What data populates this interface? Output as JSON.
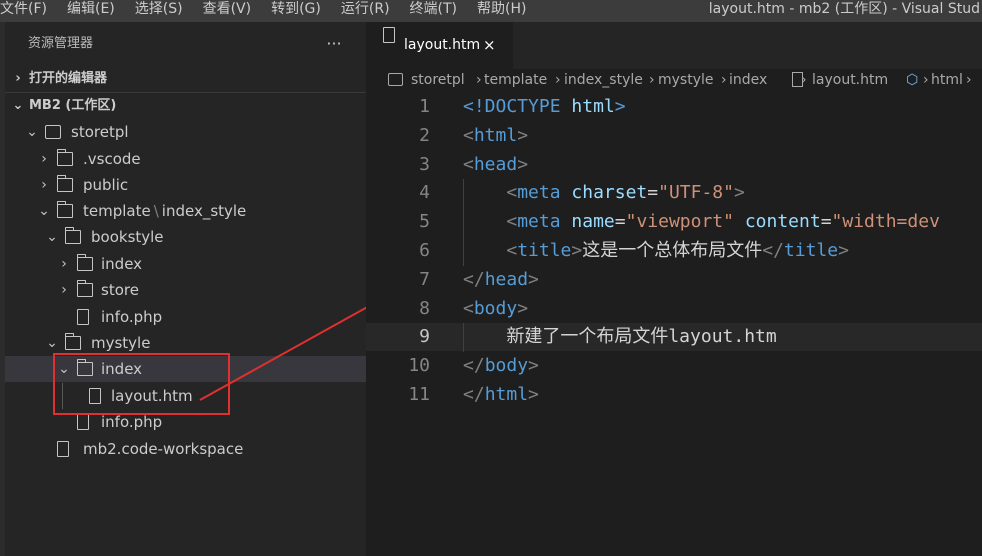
{
  "menubar": {
    "items": [
      "文件(F)",
      "编辑(E)",
      "选择(S)",
      "查看(V)",
      "转到(G)",
      "运行(R)",
      "终端(T)",
      "帮助(H)"
    ],
    "window_title": "layout.htm - mb2 (工作区) - Visual Stud"
  },
  "explorer": {
    "title": "资源管理器",
    "more": "···",
    "open_editors": "打开的编辑器",
    "workspace": "MB2 (工作区)",
    "tree": [
      {
        "label": "storetpl",
        "chevron": "⌄",
        "icon": "root-folder-icon"
      },
      {
        "label": ".vscode",
        "chevron": "›",
        "icon": "folder-icon"
      },
      {
        "label": "public",
        "chevron": "›",
        "icon": "folder-icon"
      },
      {
        "label": "template",
        "label_sep": "\\",
        "label_rest": "index_style",
        "chevron": "⌄",
        "icon": "folder-open-icon"
      },
      {
        "label": "bookstyle",
        "chevron": "⌄",
        "icon": "folder-open-icon"
      },
      {
        "label": "index",
        "chevron": "›",
        "icon": "folder-icon"
      },
      {
        "label": "store",
        "chevron": "›",
        "icon": "folder-icon"
      },
      {
        "label": "info.php",
        "icon": "file-icon"
      },
      {
        "label": "mystyle",
        "chevron": "⌄",
        "icon": "folder-open-icon"
      },
      {
        "label": "index",
        "chevron": "⌄",
        "icon": "folder-open-icon"
      },
      {
        "label": "layout.htm",
        "icon": "file-icon"
      },
      {
        "label": "info.php",
        "icon": "file-icon"
      },
      {
        "label": "mb2.code-workspace",
        "icon": "file-icon"
      }
    ]
  },
  "tab": {
    "label": "layout.htm",
    "close": "×"
  },
  "breadcrumb": {
    "items": [
      "storetpl",
      "template",
      "index_style",
      "mystyle",
      "index",
      "layout.htm",
      "html"
    ],
    "chevron": "›"
  },
  "code": {
    "line_numbers": [
      "1",
      "2",
      "3",
      "4",
      "5",
      "6",
      "7",
      "8",
      "9",
      "10",
      "11"
    ],
    "lines": [
      [
        [
          "dt",
          "<!DOCTYPE"
        ],
        [
          "tx",
          " "
        ],
        [
          "an",
          "html"
        ],
        [
          "dt",
          ">"
        ]
      ],
      [
        [
          "tg",
          "<"
        ],
        [
          "tn",
          "html"
        ],
        [
          "tg",
          ">"
        ]
      ],
      [
        [
          "tg",
          "<"
        ],
        [
          "tn",
          "head"
        ],
        [
          "tg",
          ">"
        ]
      ],
      [
        [
          "tx",
          "    "
        ],
        [
          "tg",
          "<"
        ],
        [
          "tn",
          "meta"
        ],
        [
          "tx",
          " "
        ],
        [
          "an",
          "charset"
        ],
        [
          "tx",
          "="
        ],
        [
          "av",
          "\"UTF-8\""
        ],
        [
          "tg",
          ">"
        ]
      ],
      [
        [
          "tx",
          "    "
        ],
        [
          "tg",
          "<"
        ],
        [
          "tn",
          "meta"
        ],
        [
          "tx",
          " "
        ],
        [
          "an",
          "name"
        ],
        [
          "tx",
          "="
        ],
        [
          "av",
          "\"viewport\""
        ],
        [
          "tx",
          " "
        ],
        [
          "an",
          "content"
        ],
        [
          "tx",
          "="
        ],
        [
          "av",
          "\"width=dev"
        ]
      ],
      [
        [
          "tx",
          "    "
        ],
        [
          "tg",
          "<"
        ],
        [
          "tn",
          "title"
        ],
        [
          "tg",
          ">"
        ],
        [
          "tx",
          "这是一个总体布局文件"
        ],
        [
          "tg",
          "</"
        ],
        [
          "tn",
          "title"
        ],
        [
          "tg",
          ">"
        ]
      ],
      [
        [
          "tg",
          "</"
        ],
        [
          "tn",
          "head"
        ],
        [
          "tg",
          ">"
        ]
      ],
      [
        [
          "tg",
          "<"
        ],
        [
          "tn",
          "body"
        ],
        [
          "tg",
          ">"
        ]
      ],
      [
        [
          "tx",
          "    新建了一个布局文件layout.htm"
        ]
      ],
      [
        [
          "tg",
          "</"
        ],
        [
          "tn",
          "body"
        ],
        [
          "tg",
          ">"
        ]
      ],
      [
        [
          "tg",
          "</"
        ],
        [
          "tn",
          "html"
        ],
        [
          "tg",
          ">"
        ]
      ]
    ],
    "current_line": 9
  },
  "colors": {
    "annotation": "#e03030",
    "tag": "#569cd6",
    "attribute": "#9cdcfe",
    "string": "#ce9178"
  }
}
